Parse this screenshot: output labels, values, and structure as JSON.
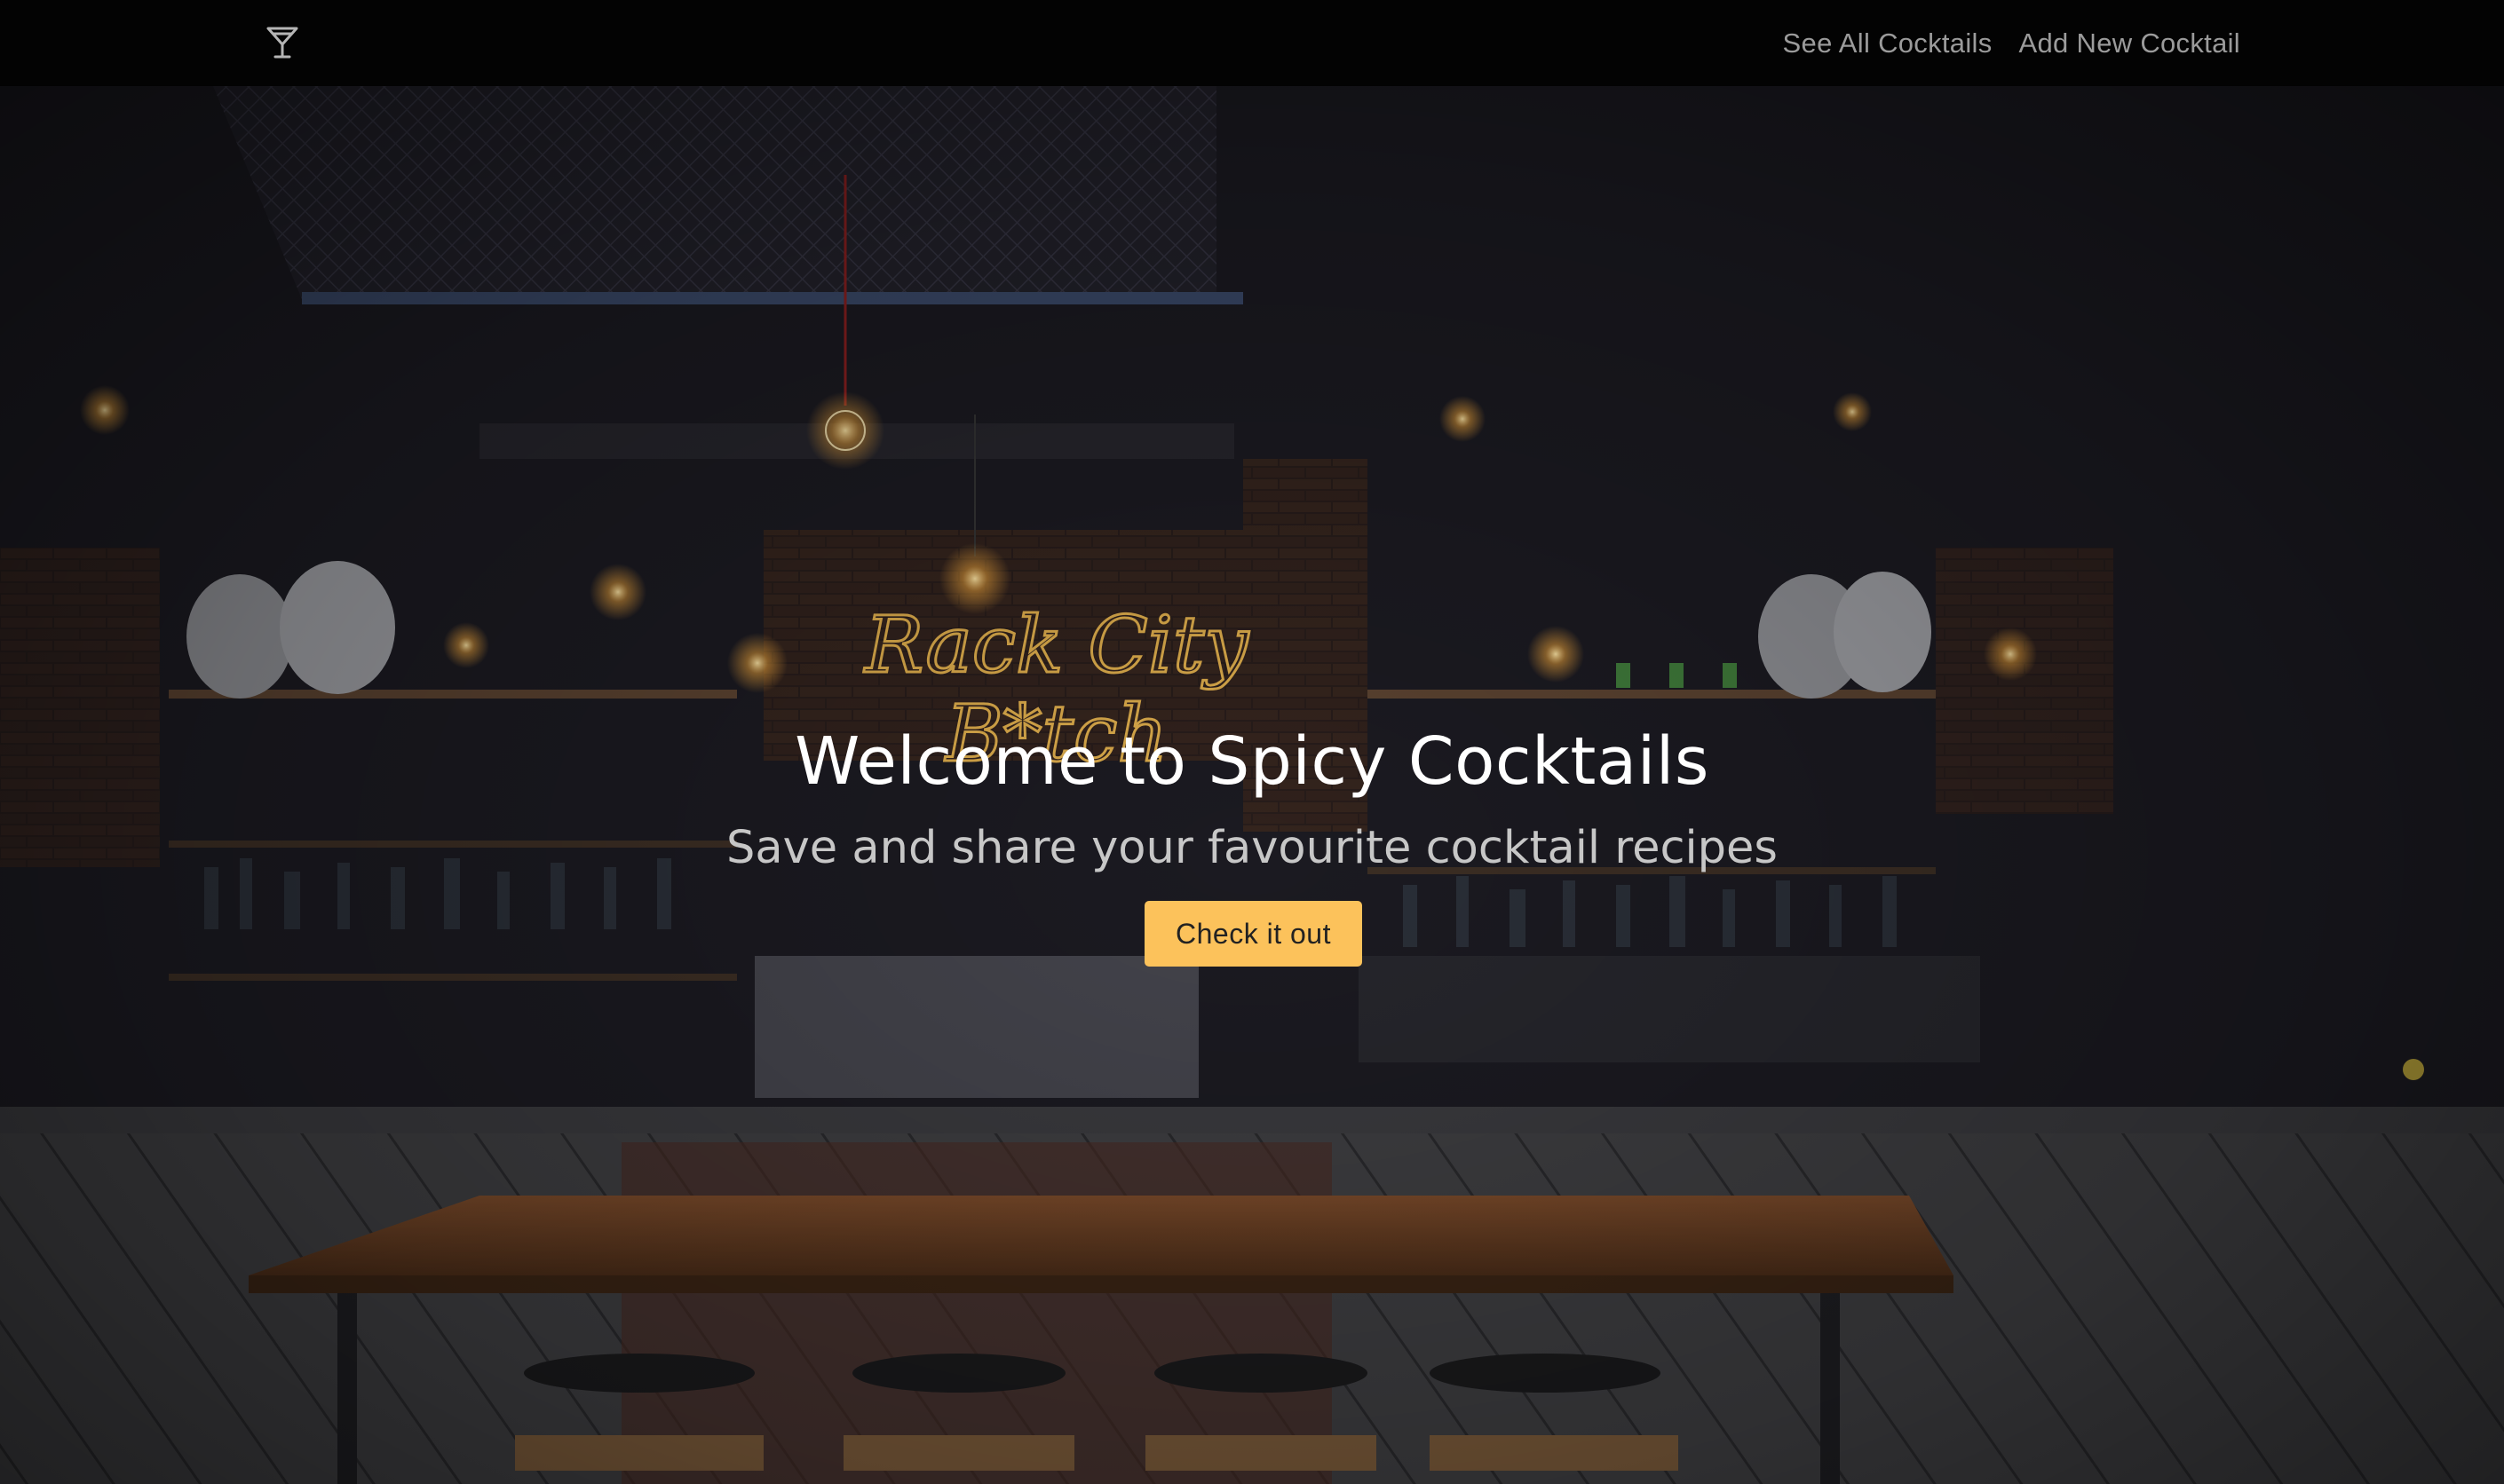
{
  "navbar": {
    "brand_icon": "cocktail-glass-icon",
    "links": [
      {
        "label": "See All Cocktails"
      },
      {
        "label": "Add New Cocktail"
      }
    ]
  },
  "hero": {
    "title": "Welcome to Spicy Cocktails",
    "subtitle": "Save and share your favourite cocktail recipes",
    "cta_label": "Check it out",
    "neon_sign_line1": "Rack City",
    "neon_sign_line2": "B*tch",
    "background_scene": "dimly-lit-bar-interior",
    "colors": {
      "accent": "#fcc25b",
      "neon": "#e0b24a",
      "navbar": "#030303"
    }
  }
}
